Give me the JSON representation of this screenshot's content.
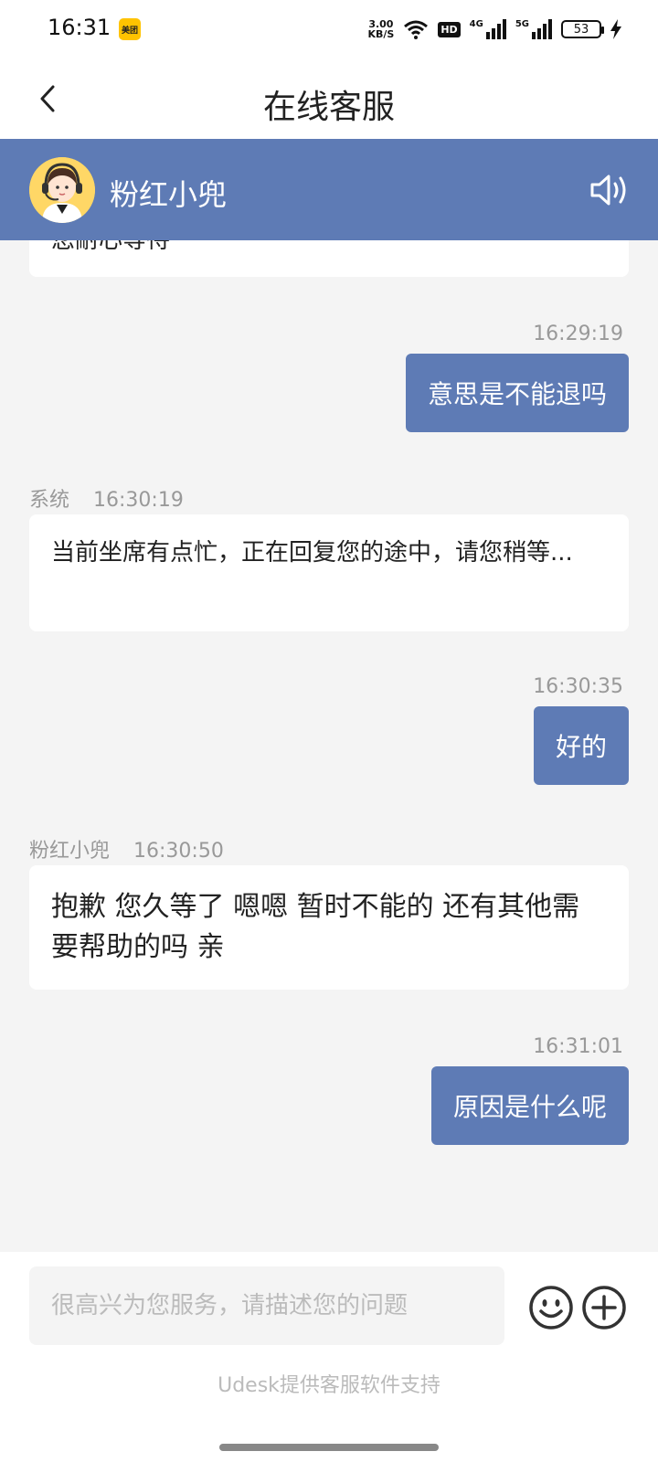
{
  "status_bar": {
    "time": "16:31",
    "app_badge": "美团",
    "net_speed_value": "3.00",
    "net_speed_unit": "KB/S",
    "hd_label": "HD",
    "sig1_label": "4G",
    "sig2_label": "5G",
    "battery": "53",
    "icons": [
      "wifi-icon",
      "signal-icon",
      "charging-icon"
    ]
  },
  "header": {
    "title": "在线客服",
    "back_icon": "chevron-left-icon"
  },
  "agent": {
    "name": "粉红小兜",
    "avatar_icon": "headset-agent-avatar",
    "speaker_icon": "speaker-icon",
    "bar_color": "#5e7bb5"
  },
  "messages": [
    {
      "side": "left",
      "text": "您耐心等待"
    },
    {
      "side": "right",
      "time": "16:29:19",
      "text": "意思是不能退吗"
    },
    {
      "side": "left",
      "sender": "系统",
      "time": "16:30:19",
      "text": "当前坐席有点忙，正在回复您的途中，请您稍等..."
    },
    {
      "side": "right",
      "time": "16:30:35",
      "text": "好的"
    },
    {
      "side": "left",
      "sender": "粉红小兜",
      "time": "16:30:50",
      "text": "抱歉 您久等了 嗯嗯 暂时不能的 还有其他需要帮助的吗 亲"
    },
    {
      "side": "right",
      "time": "16:31:01",
      "text": "原因是什么呢"
    }
  ],
  "input": {
    "placeholder": "很高兴为您服务，请描述您的问题",
    "value": "",
    "emoji_icon": "emoji-icon",
    "plus_icon": "plus-icon"
  },
  "footer_note": "Udesk提供客服软件支持",
  "colors": {
    "accent": "#5e7bb5",
    "chat_bg": "#f4f4f4",
    "meta_text": "#999999"
  }
}
